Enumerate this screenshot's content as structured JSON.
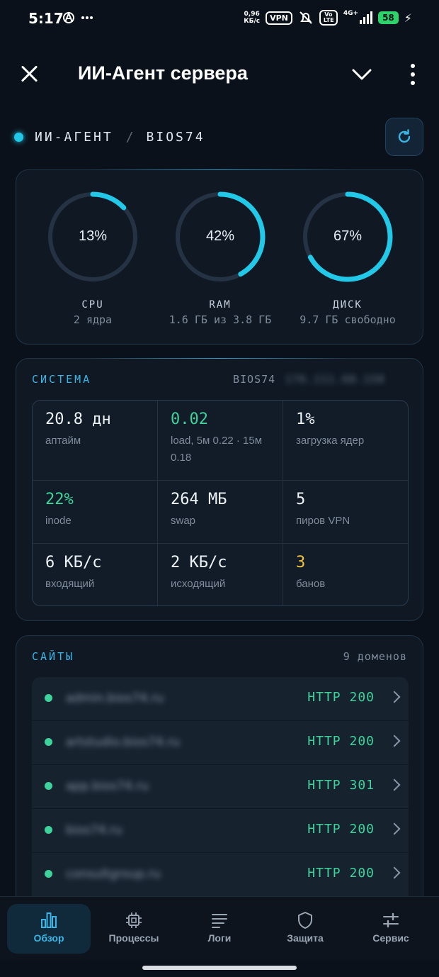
{
  "status_bar": {
    "time": "5:17",
    "net_speed_value": "0,96",
    "net_speed_unit": "КБ/с",
    "vpn": "VPN",
    "volte": "Vo LTE",
    "network": "4G+",
    "battery": "58"
  },
  "appbar": {
    "title": "ИИ-Агент сервера"
  },
  "breadcrumb": {
    "root": "ИИ-АГЕНТ",
    "separator": "/",
    "host": "BIOS74"
  },
  "gauges": [
    {
      "name": "CPU",
      "percent_label": "13%",
      "fraction": 0.13,
      "sub": "2 ядра"
    },
    {
      "name": "RAM",
      "percent_label": "42%",
      "fraction": 0.42,
      "sub": "1.6 ГБ из 3.8 ГБ"
    },
    {
      "name": "ДИСК",
      "percent_label": "67%",
      "fraction": 0.67,
      "sub": "9.7 ГБ свободно"
    }
  ],
  "system": {
    "label": "СИСТЕМА",
    "host": "BIOS74",
    "host_blurred": "176.111.68.150",
    "cells": [
      {
        "value": "20.8 дн",
        "label": "аптайм"
      },
      {
        "value": "0.02",
        "label": "load, 5м 0.22 · 15м 0.18"
      },
      {
        "value": "1%",
        "label": "загрузка ядер"
      },
      {
        "value": "22%",
        "label": "inode"
      },
      {
        "value": "264 МБ",
        "label": "swap"
      },
      {
        "value": "5",
        "label": "пиров VPN"
      },
      {
        "value": "6 КБ/с",
        "label": "входящий"
      },
      {
        "value": "2 КБ/с",
        "label": "исходящий"
      },
      {
        "value": "3",
        "label": "банов"
      }
    ]
  },
  "sites": {
    "label": "САЙТЫ",
    "count": "9 доменов",
    "rows": [
      {
        "domain": "admin.bios74.ru",
        "status": "HTTP 200"
      },
      {
        "domain": "artstudio.bios74.ru",
        "status": "HTTP 200"
      },
      {
        "domain": "app.bios74.ru",
        "status": "HTTP 301"
      },
      {
        "domain": "bios74.ru",
        "status": "HTTP 200"
      },
      {
        "domain": "consultgroup.ru",
        "status": "HTTP 200"
      }
    ]
  },
  "nav": [
    {
      "label": "Обзор",
      "icon": "bar-chart-icon"
    },
    {
      "label": "Процессы",
      "icon": "chip-icon"
    },
    {
      "label": "Логи",
      "icon": "lines-icon"
    },
    {
      "label": "Защита",
      "icon": "shield-icon"
    },
    {
      "label": "Сервис",
      "icon": "sliders-icon"
    }
  ],
  "colors": {
    "accent": "#22c8e8",
    "ring_track": "#253244",
    "ok": "#3ed39a",
    "warn": "#f1c23c",
    "background": "#0b111a"
  }
}
